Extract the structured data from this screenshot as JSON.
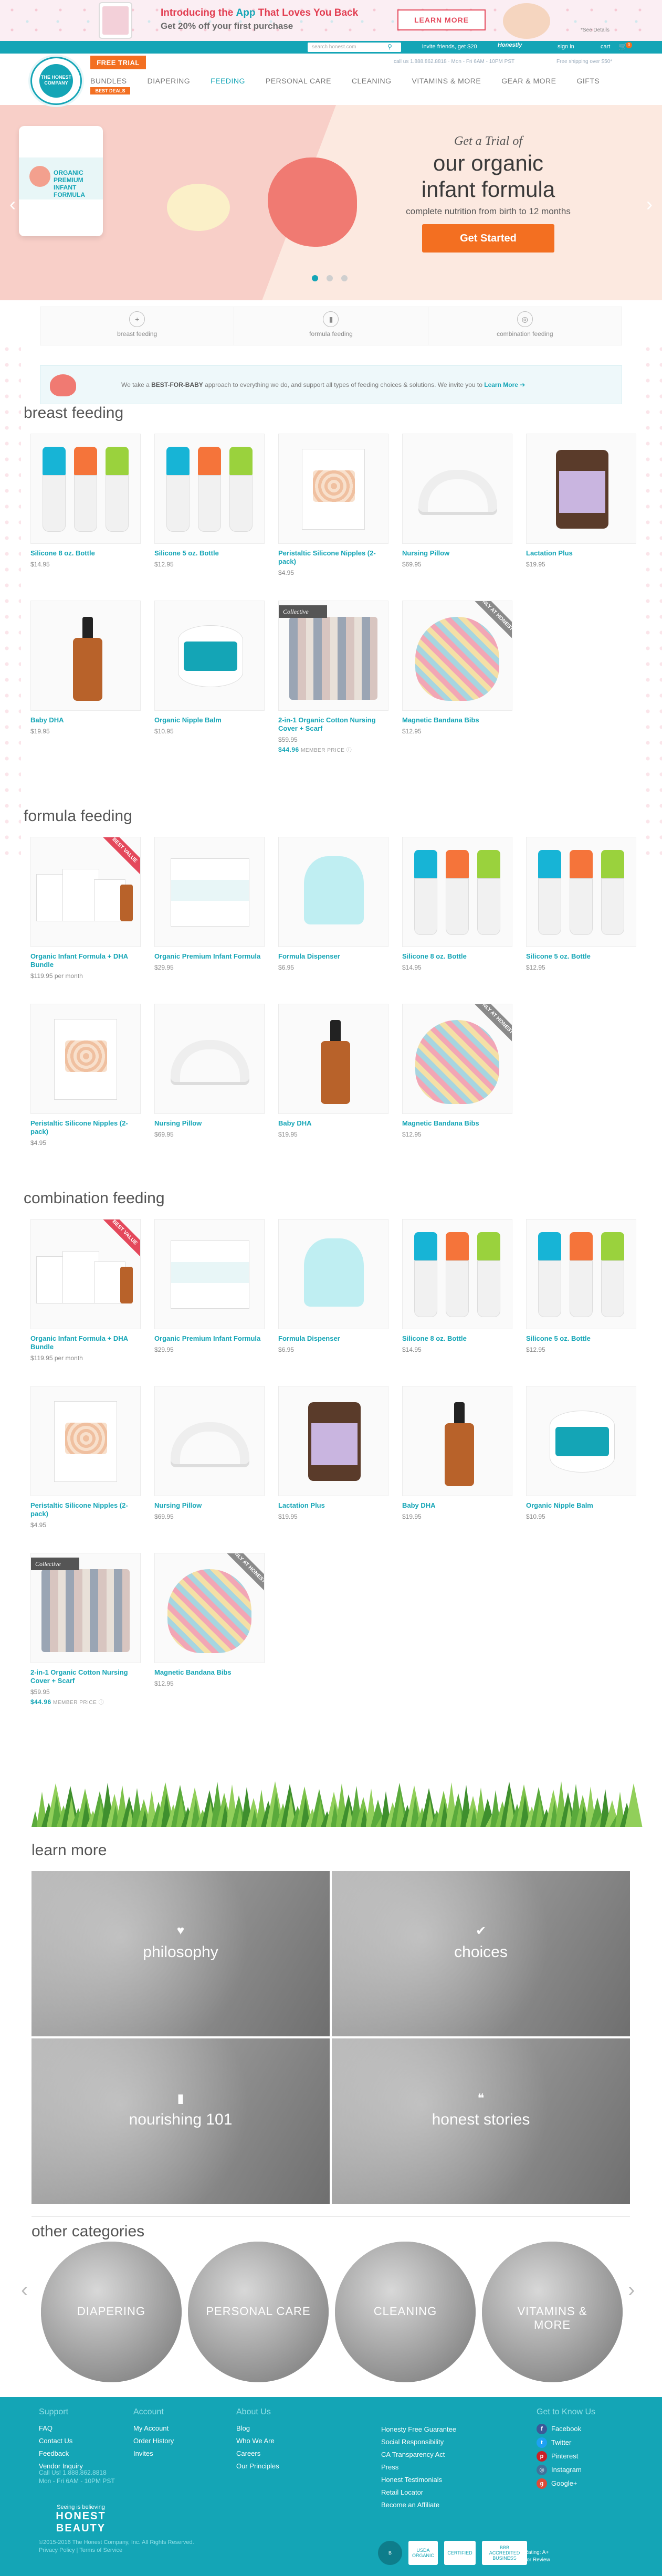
{
  "promo": {
    "title_pre": "Introducing the ",
    "title_app": "App",
    "title_post": " That Loves You Back",
    "subtitle": "Get 20% off your first purchase",
    "cta": "LEARN MORE",
    "see_details": "*See Details"
  },
  "utilbar": {
    "search_placeholder": "search honest.com",
    "invite": "invite friends, get $20",
    "wellness_logo": "Honestly",
    "signin": "sign in",
    "cart": "cart",
    "cart_count": "0"
  },
  "header": {
    "logo_text": "THE HONEST COMPANY",
    "free_trial": "FREE TRIAL",
    "contact": "call us 1.888.862.8818 · Mon - Fri 6AM - 10PM PST",
    "trust": "Free shipping over $50*",
    "best_deals": "BEST DEALS",
    "nav": [
      {
        "label": "BUNDLES",
        "active": false
      },
      {
        "label": "DIAPERING",
        "active": false
      },
      {
        "label": "FEEDING",
        "active": true
      },
      {
        "label": "PERSONAL CARE",
        "active": false
      },
      {
        "label": "CLEANING",
        "active": false
      },
      {
        "label": "VITAMINS & MORE",
        "active": false
      },
      {
        "label": "GEAR & MORE",
        "active": false
      },
      {
        "label": "GIFTS",
        "active": false
      }
    ]
  },
  "hero": {
    "kicker": "Get a Trial of",
    "headline_1": "our organic",
    "headline_2": "infant formula",
    "subhead": "complete nutrition from birth to 12 months",
    "cta": "Get Started",
    "tin_text": "ORGANIC PREMIUM INFANT FORMULA"
  },
  "jump": [
    {
      "label": "breast feeding",
      "icon": "circle-plus-icon"
    },
    {
      "label": "formula feeding",
      "icon": "bottle-icon"
    },
    {
      "label": "combination feeding",
      "icon": "combo-icon"
    }
  ],
  "note": {
    "pre": "We take a ",
    "bold": "BEST-FOR-BABY",
    "post": " approach to everything we do, and support all types of feeding choices & solutions. We invite you to ",
    "link": "Learn More ➔"
  },
  "sections": {
    "breast": {
      "title": "breast feeding",
      "products": [
        {
          "name": "Silicone 8 oz. Bottle",
          "price": "$14.95"
        },
        {
          "name": "Silicone 5 oz. Bottle",
          "price": "$12.95"
        },
        {
          "name": "Peristaltic Silicone Nipples (2-pack)",
          "price": "$4.95"
        },
        {
          "name": "Nursing Pillow",
          "price": "$69.95"
        },
        {
          "name": "Lactation Plus",
          "price": "$19.95"
        },
        {
          "name": "Baby DHA",
          "price": "$19.95"
        },
        {
          "name": "Organic Nipple Balm",
          "price": "$10.95"
        },
        {
          "name": "2-in-1 Organic Cotton Nursing Cover + Scarf",
          "price": "$59.95",
          "member_price": "$44.96",
          "member_label": "MEMBER PRICE",
          "ribbon": "Collective"
        },
        {
          "name": "Magnetic Bandana Bibs",
          "price": "$12.95",
          "corner": "ONLY AT HONEST"
        }
      ]
    },
    "formula": {
      "title": "formula feeding",
      "products": [
        {
          "name": "Organic Infant Formula + DHA Bundle",
          "price": "$119.95 per month",
          "corner": "BEST VALUE"
        },
        {
          "name": "Organic Premium Infant Formula",
          "price": "$29.95"
        },
        {
          "name": "Formula Dispenser",
          "price": "$6.95"
        },
        {
          "name": "Silicone 8 oz. Bottle",
          "price": "$14.95"
        },
        {
          "name": "Silicone 5 oz. Bottle",
          "price": "$12.95"
        },
        {
          "name": "Peristaltic Silicone Nipples (2-pack)",
          "price": "$4.95"
        },
        {
          "name": "Nursing Pillow",
          "price": "$69.95"
        },
        {
          "name": "Baby DHA",
          "price": "$19.95"
        },
        {
          "name": "Magnetic Bandana Bibs",
          "price": "$12.95",
          "corner": "ONLY AT HONEST"
        }
      ]
    },
    "combo": {
      "title": "combination feeding",
      "products": [
        {
          "name": "Organic Infant Formula + DHA Bundle",
          "price": "$119.95 per month",
          "corner": "BEST VALUE"
        },
        {
          "name": "Organic Premium Infant Formula",
          "price": "$29.95"
        },
        {
          "name": "Formula Dispenser",
          "price": "$6.95"
        },
        {
          "name": "Silicone 8 oz. Bottle",
          "price": "$14.95"
        },
        {
          "name": "Silicone 5 oz. Bottle",
          "price": "$12.95"
        },
        {
          "name": "Peristaltic Silicone Nipples (2-pack)",
          "price": "$4.95"
        },
        {
          "name": "Nursing Pillow",
          "price": "$69.95"
        },
        {
          "name": "Lactation Plus",
          "price": "$19.95"
        },
        {
          "name": "Baby DHA",
          "price": "$19.95"
        },
        {
          "name": "Organic Nipple Balm",
          "price": "$10.95"
        },
        {
          "name": "2-in-1 Organic Cotton Nursing Cover + Scarf",
          "price": "$59.95",
          "member_price": "$44.96",
          "member_label": "MEMBER PRICE",
          "ribbon": "Collective"
        },
        {
          "name": "Magnetic Bandana Bibs",
          "price": "$12.95",
          "corner": "ONLY AT HONEST"
        }
      ]
    }
  },
  "learn": {
    "title": "learn more",
    "tiles": [
      {
        "label": "philosophy",
        "icon": "heart-icon"
      },
      {
        "label": "choices",
        "icon": "check-icon"
      },
      {
        "label": "nourishing 101",
        "icon": "bottle-icon"
      },
      {
        "label": "honest stories",
        "icon": "quote-icon"
      }
    ]
  },
  "other": {
    "title": "other categories",
    "items": [
      "DIAPERING",
      "PERSONAL CARE",
      "CLEANING",
      "VITAMINS & MORE"
    ]
  },
  "footer": {
    "support": {
      "title": "Support",
      "links": [
        "FAQ",
        "Contact Us",
        "Feedback",
        "Vendor Inquiry"
      ]
    },
    "account": {
      "title": "Account",
      "links": [
        "My Account",
        "Order History",
        "Invites"
      ]
    },
    "about": {
      "title": "About Us",
      "links": [
        "Blog",
        "Who We Are",
        "Careers",
        "Our Principles"
      ]
    },
    "about2": {
      "links": [
        "Honesty Free Guarantee",
        "Social Responsibility",
        "CA Transparency Act",
        "Press",
        "Honest Testimonials",
        "Retail Locator",
        "Become an Affiliate"
      ]
    },
    "social": {
      "title": "Get to Know Us",
      "links": [
        "Facebook",
        "Twitter",
        "Pinterest",
        "Instagram",
        "Google+"
      ]
    },
    "call_1": "Call Us! 1.888.862.8818",
    "call_2": "Mon - Fri 6AM - 10PM PST",
    "seeing": "Seeing is believing",
    "honest_beauty": "HONEST BEAUTY",
    "copyright": "©2015-2016 The Honest Company, Inc. All Rights Reserved.",
    "policy": "Privacy Policy  |  Terms of Service",
    "seals": [
      "B",
      "USDA ORGANIC",
      "CERTIFIED",
      "BBB ACCREDITED BUSINESS"
    ],
    "bbb_1": "BBB Rating: A+",
    "bbb_2": "Click for Review"
  },
  "colors": {
    "teal": "#14a5b6",
    "orange": "#f36f21",
    "red": "#e4485b"
  }
}
